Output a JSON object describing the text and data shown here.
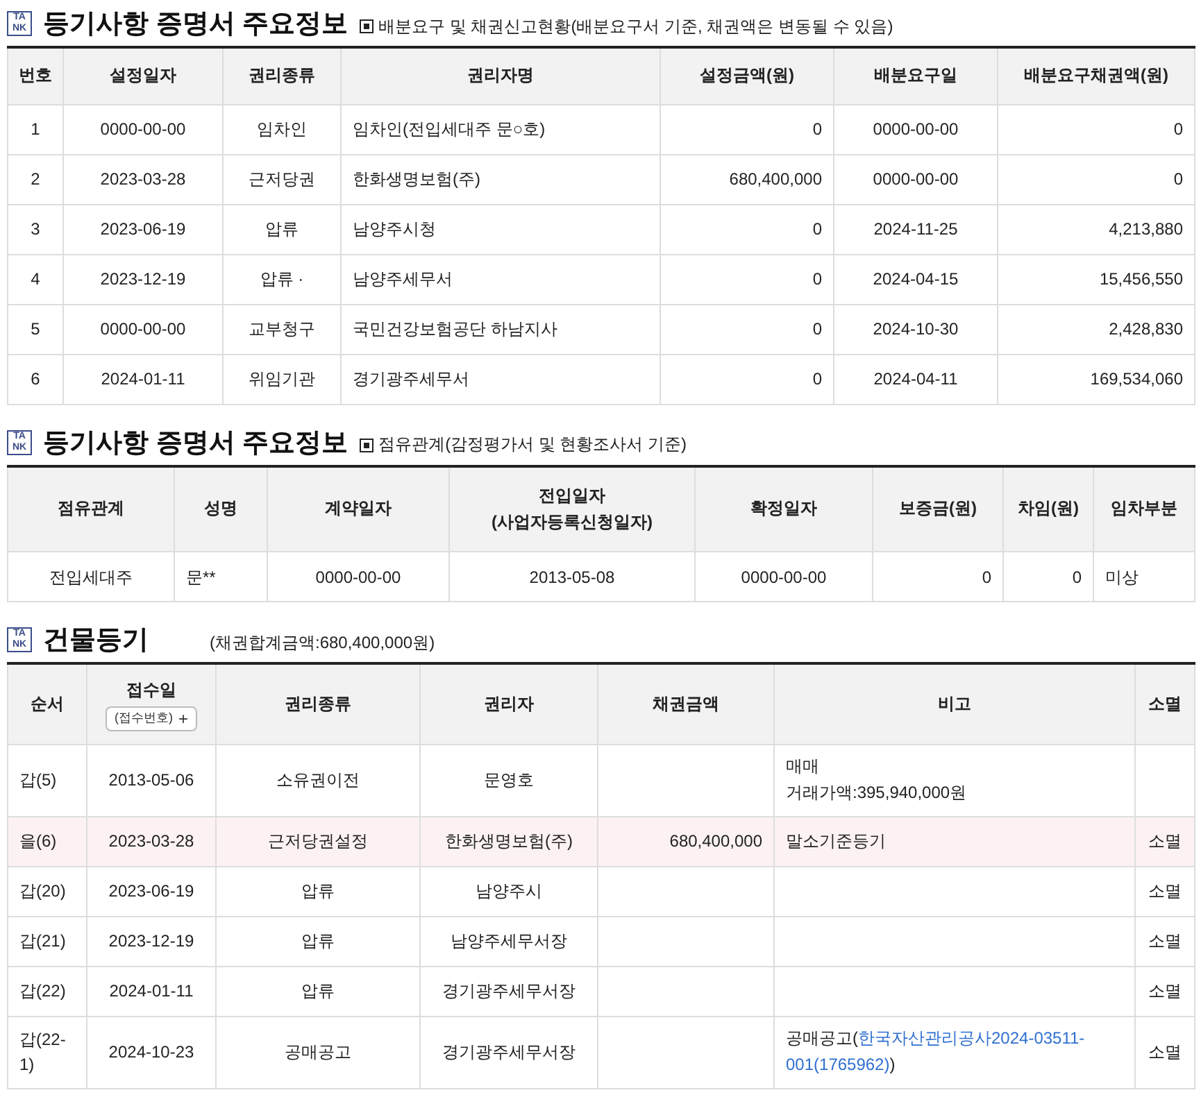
{
  "sections": [
    {
      "logo": [
        "TA",
        "NK"
      ],
      "title": "등기사항 증명서 주요정보",
      "subtitle": "배분요구 및 채권신고현황(배분요구서 기준, 채권액은 변동될 수 있음)",
      "subtitle_bullet": true,
      "columns": [
        "번호",
        "설정일자",
        "권리종류",
        "권리자명",
        "설정금액(원)",
        "배분요구일",
        "배분요구채권액(원)"
      ],
      "rows": [
        {
          "cells": [
            "1",
            "0000-00-00",
            "임차인",
            "임차인(전입세대주 문○호)",
            "0",
            "0000-00-00",
            "0"
          ]
        },
        {
          "cells": [
            "2",
            "2023-03-28",
            "근저당권",
            "한화생명보험(주)",
            "680,400,000",
            "0000-00-00",
            "0"
          ]
        },
        {
          "cells": [
            "3",
            "2023-06-19",
            "압류",
            "남양주시청",
            "0",
            "2024-11-25",
            "4,213,880"
          ]
        },
        {
          "cells": [
            "4",
            "2023-12-19",
            "압류 ·",
            "남양주세무서",
            "0",
            "2024-04-15",
            "15,456,550"
          ]
        },
        {
          "cells": [
            "5",
            "0000-00-00",
            "교부청구",
            "국민건강보험공단 하남지사",
            "0",
            "2024-10-30",
            "2,428,830"
          ]
        },
        {
          "cells": [
            "6",
            "2024-01-11",
            "위임기관",
            "경기광주세무서",
            "0",
            "2024-04-11",
            "169,534,060"
          ]
        }
      ]
    },
    {
      "logo": [
        "TA",
        "NK"
      ],
      "title": "등기사항 증명서 주요정보",
      "subtitle": "점유관계(감정평가서 및 현황조사서 기준)",
      "subtitle_bullet": true,
      "columns": [
        "점유관계",
        "성명",
        "계약일자",
        "전입일자\n(사업자등록신청일자)",
        "확정일자",
        "보증금(원)",
        "차임(원)",
        "임차부분"
      ],
      "rows": [
        {
          "cells": [
            "전입세대주",
            "문**",
            "0000-00-00",
            "2013-05-08",
            "0000-00-00",
            "0",
            "0",
            "미상"
          ]
        }
      ]
    },
    {
      "logo": [
        "TA",
        "NK"
      ],
      "title": "건물등기",
      "subtitle": "(채권합계금액:680,400,000원)",
      "subtitle_bullet": false,
      "columns": [
        "순서",
        "접수일",
        "권리종류",
        "권리자",
        "채권금액",
        "비고",
        "소멸"
      ],
      "column_button": {
        "label": "(접수번호)",
        "icon": "+"
      },
      "rows": [
        {
          "highlighted": false,
          "cells": [
            "갑(5)",
            "2013-05-06",
            "소유권이전",
            "문영호",
            "",
            [
              [
                {
                  "text": "매매",
                  "link": false
                }
              ],
              [
                {
                  "text": "거래가액:395,940,000원",
                  "link": false
                }
              ]
            ],
            ""
          ]
        },
        {
          "highlighted": true,
          "cells": [
            "을(6)",
            "2023-03-28",
            "근저당권설정",
            "한화생명보험(주)",
            "680,400,000",
            [
              [
                {
                  "text": "말소기준등기",
                  "link": false
                }
              ]
            ],
            "소멸"
          ]
        },
        {
          "highlighted": false,
          "cells": [
            "갑(20)",
            "2023-06-19",
            "압류",
            "남양주시",
            "",
            [],
            "소멸"
          ]
        },
        {
          "highlighted": false,
          "cells": [
            "갑(21)",
            "2023-12-19",
            "압류",
            "남양주세무서장",
            "",
            [],
            "소멸"
          ]
        },
        {
          "highlighted": false,
          "cells": [
            "갑(22)",
            "2024-01-11",
            "압류",
            "경기광주세무서장",
            "",
            [],
            "소멸"
          ]
        },
        {
          "highlighted": false,
          "cells": [
            "갑(22-\n1)",
            "2024-10-23",
            "공매공고",
            "경기광주세무서장",
            "",
            [
              [
                {
                  "text": "공매공고(",
                  "link": false
                },
                {
                  "text": "한국자산관리공사2024-03511-",
                  "link": true
                }
              ],
              [
                {
                  "text": "001(1765962)",
                  "link": true
                },
                {
                  "text": ")",
                  "link": false
                }
              ]
            ],
            "소멸"
          ]
        }
      ]
    }
  ]
}
